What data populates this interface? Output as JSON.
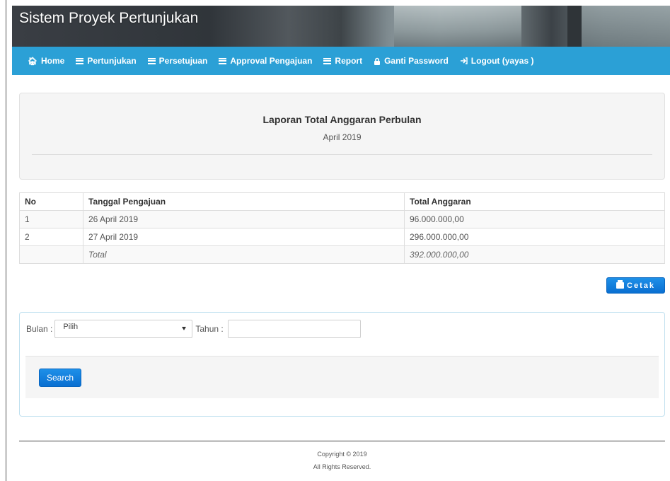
{
  "header": {
    "title": "Sistem Proyek Pertunjukan"
  },
  "nav": {
    "items": [
      {
        "label": "Home",
        "icon": "home-icon"
      },
      {
        "label": "Pertunjukan",
        "icon": "list-icon"
      },
      {
        "label": "Persetujuan",
        "icon": "list-icon"
      },
      {
        "label": "Approval Pengajuan",
        "icon": "list-icon"
      },
      {
        "label": "Report",
        "icon": "list-icon"
      },
      {
        "label": "Ganti Password",
        "icon": "lock-icon"
      },
      {
        "label": "Logout (yayas )",
        "icon": "logout-icon"
      }
    ],
    "color": "#2ba0d6"
  },
  "report": {
    "title": "Laporan Total Anggaran Perbulan",
    "period": "April 2019"
  },
  "table": {
    "headers": [
      "No",
      "Tanggal Pengajuan",
      "Total Anggaran"
    ],
    "rows": [
      [
        "1",
        "26 April 2019",
        "96.000.000,00"
      ],
      [
        "2",
        "27 April 2019",
        "296.000.000,00"
      ]
    ],
    "total": {
      "no": "",
      "label": "Total",
      "value": "392.000.000,00"
    }
  },
  "print_button": {
    "label": "Cetak",
    "icon": "print-icon"
  },
  "filter": {
    "month_label": "Bulan :",
    "month_value": "Pilih",
    "year_label": "Tahun :",
    "year_value": "",
    "search_label": "Search"
  },
  "footer": {
    "copyright": "Copyright © 2019",
    "rights": "All Rights Reserved."
  },
  "colors": {
    "primary_button": "#0a6fd1",
    "navbar": "#2ba0d6"
  }
}
